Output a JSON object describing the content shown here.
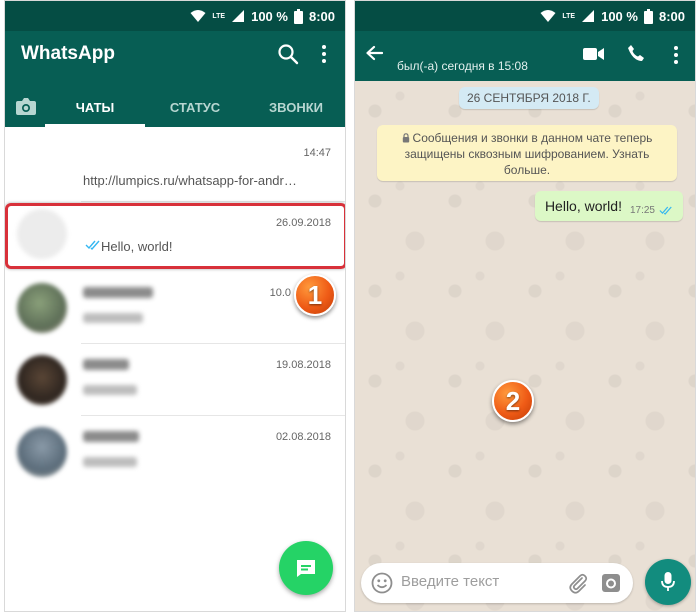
{
  "status_bar": {
    "network": "LTE",
    "battery": "100 %",
    "time": "8:00"
  },
  "chat_list": {
    "title": "WhatsApp",
    "tabs": [
      {
        "label": "ЧАТЫ",
        "active": true
      },
      {
        "label": "СТАТУС",
        "active": false
      },
      {
        "label": "ЗВОНКИ",
        "active": false
      }
    ],
    "rows": [
      {
        "name": "",
        "time": "14:47",
        "preview": "http://lumpics.ru/whatsapp-for-andr…"
      },
      {
        "name": "",
        "time": "26.09.2018",
        "preview": "Hello, world!"
      },
      {
        "name": "",
        "time": "10.0",
        "preview": ""
      },
      {
        "name": "",
        "time": "19.08.2018",
        "preview": ""
      },
      {
        "name": "",
        "time": "02.08.2018",
        "preview": ""
      }
    ]
  },
  "chat": {
    "last_seen": "был(-а) сегодня в 15:08",
    "date_label": "26 СЕНТЯБРЯ 2018 Г.",
    "encryption_notice": "Сообщения и звонки в данном чате теперь защищены сквозным шифрованием. Узнать больше.",
    "message": {
      "text": "Hello, world!",
      "time": "17:25",
      "status": "read"
    },
    "input_placeholder": "Введите текст"
  },
  "badges": {
    "one": "1",
    "two": "2"
  },
  "colors": {
    "header": "#075e54",
    "status_bar": "#054d44",
    "accent": "#25d366",
    "bubble_out": "#dcf8c6",
    "highlight": "#d8313a",
    "badge": "#ef5b16",
    "read_ticks": "#34b7f1"
  },
  "icons": [
    "search-icon",
    "more-vert-icon",
    "camera-icon",
    "new-chat-icon",
    "back-arrow-icon",
    "video-call-icon",
    "phone-icon",
    "emoji-icon",
    "attach-icon",
    "camera-icon",
    "mic-icon",
    "double-check-icon",
    "lock-icon",
    "wifi-icon",
    "signal-icon",
    "battery-icon"
  ]
}
